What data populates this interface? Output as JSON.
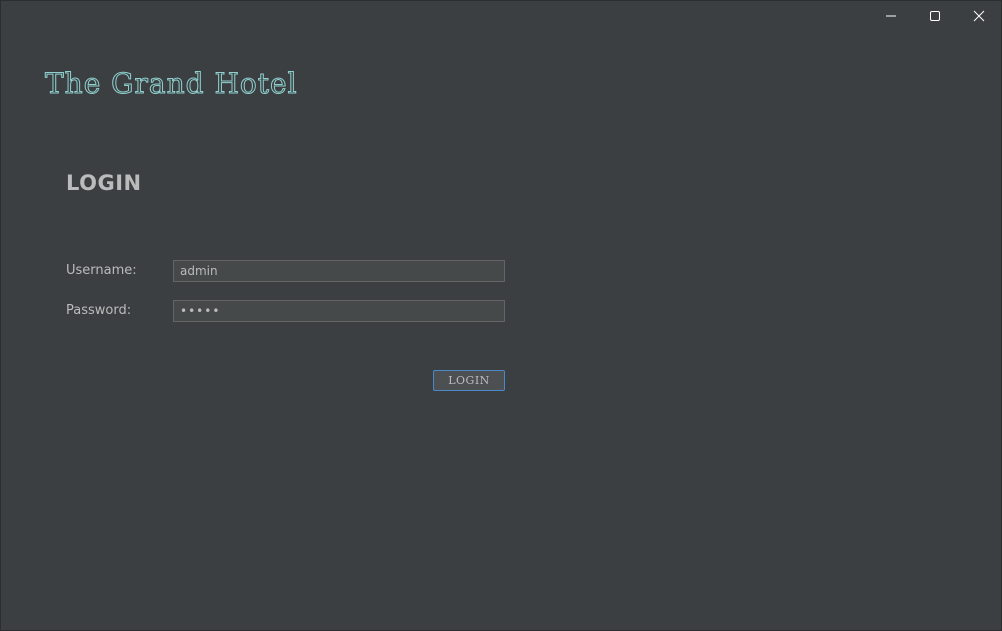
{
  "window": {
    "controls": {
      "minimize_icon": "minimize-icon",
      "maximize_icon": "maximize-icon",
      "close_icon": "close-icon"
    }
  },
  "brand": {
    "title": "The Grand Hotel",
    "color": "#8fd0cf"
  },
  "login": {
    "heading": "LOGIN",
    "username_label": "Username:",
    "username_value": "admin",
    "password_label": "Password:",
    "password_value": "•••••",
    "button_label": "LOGIN",
    "button_border_color": "#4a88c7"
  },
  "theme": {
    "background": "#3c3f41",
    "text": "#bbbbbb"
  }
}
